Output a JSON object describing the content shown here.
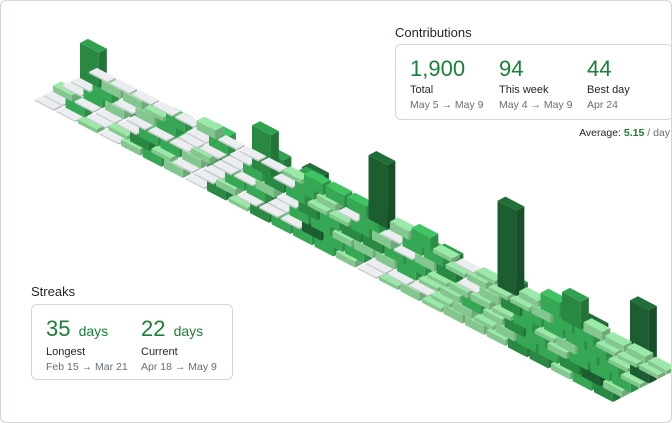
{
  "contributions": {
    "title": "Contributions",
    "stats": [
      {
        "value": "1,900",
        "label": "Total",
        "range": "May 5 → May 9"
      },
      {
        "value": "94",
        "label": "This week",
        "range": "May 4 → May 9"
      },
      {
        "value": "44",
        "label": "Best day",
        "range": "Apr 24"
      }
    ],
    "average": {
      "label": "Average:",
      "value": "5.15",
      "unit": "/ day"
    }
  },
  "streaks": {
    "title": "Streaks",
    "stats": [
      {
        "value": "35",
        "unit": "days",
        "label": "Longest",
        "range": "Feb 15 → Mar 21"
      },
      {
        "value": "22",
        "unit": "days",
        "label": "Current",
        "range": "Apr 18 → May 9"
      }
    ]
  },
  "colors": {
    "accent": "#1a7f37",
    "levels": [
      "#ebedf0",
      "#9be9a8",
      "#40c463",
      "#30a14e",
      "#216e39"
    ]
  }
}
